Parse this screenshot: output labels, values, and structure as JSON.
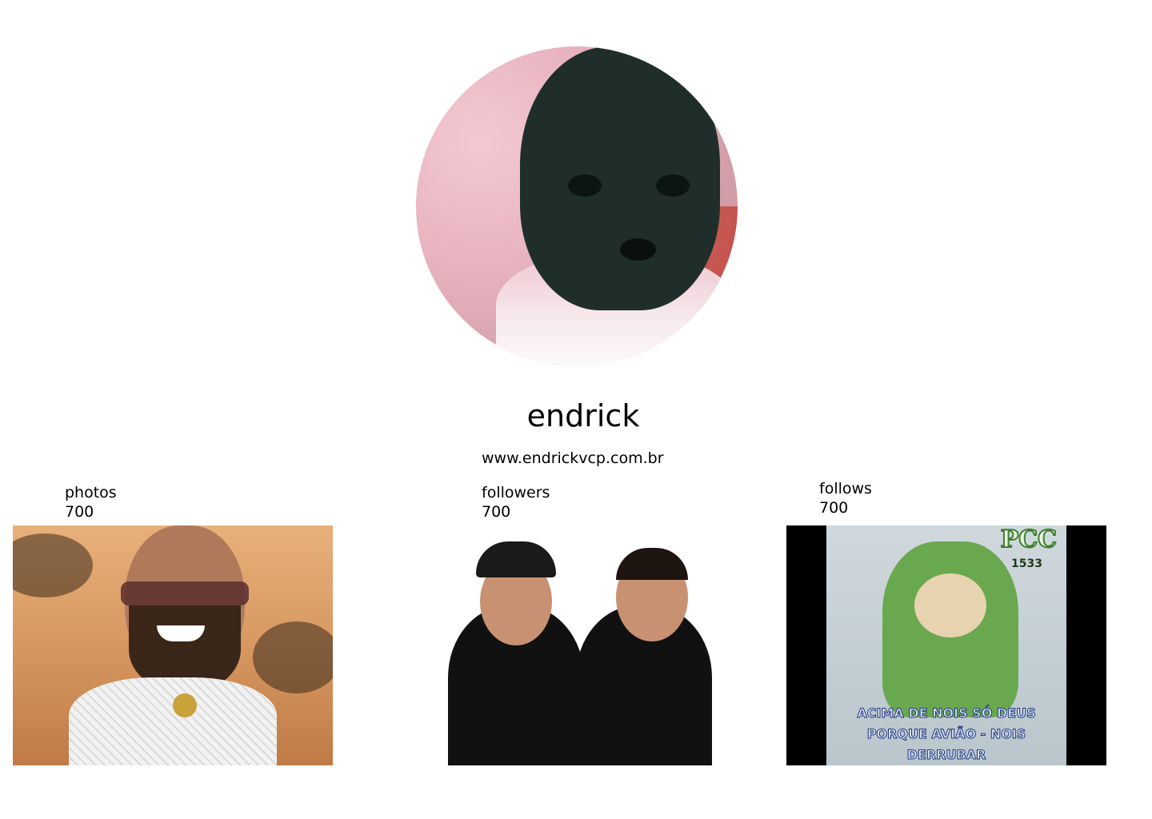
{
  "profile": {
    "username": "endrick",
    "website": "www.endrickvcp.com.br"
  },
  "stats": {
    "photos": {
      "label": "photos",
      "value": "700"
    },
    "followers": {
      "label": "followers",
      "value": "700"
    },
    "follows": {
      "label": "follows",
      "value": "700"
    }
  },
  "thumbnails": {
    "meme": {
      "brand": "PCC",
      "number": "1533",
      "caption_line1": "ACIMA DE NOIS SÓ DEUS",
      "caption_line2": "PORQUE AVIÃO - NOIS",
      "caption_line3": "DERRUBAR"
    }
  }
}
